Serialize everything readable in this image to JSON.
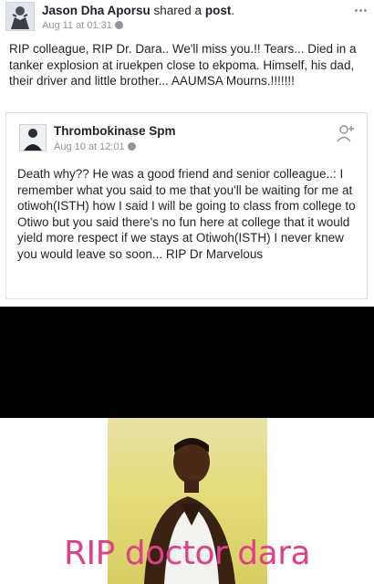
{
  "header": {
    "author": "Jason Dha Aporsu",
    "action": " shared a ",
    "object": "post",
    "period": ".",
    "timestamp": "Aug 11 at 01:31"
  },
  "post": {
    "text": "RIP colleague, RIP Dr. Dara.. We'll miss you.!! Tears... Died in a tanker explosion at iruekpen close to ekpoma. Himself, his dad, their driver and little brother... AAUMSA Mourns.!!!!!!!"
  },
  "shared": {
    "author": "Thrombokinase Spm",
    "timestamp": "Aug 10 at 12:01",
    "text": "Death why?? He was a good friend and senior colleague..: I remember what you said to me that you'll be waiting for me at otiwoh(ISTH) how I said I will be going to class from college to Otiwo but you said there's no fun here at college that it would yield more respect if we stays at Otiwoh(ISTH) I never knew you would leave so soon... RIP Dr Marvelous"
  },
  "image": {
    "caption": "RIP doctor dara",
    "caption_color": "#e0408a"
  },
  "icons": {
    "more": "more-options-icon",
    "globe": "globe-icon",
    "add_friend": "add-friend-icon"
  }
}
